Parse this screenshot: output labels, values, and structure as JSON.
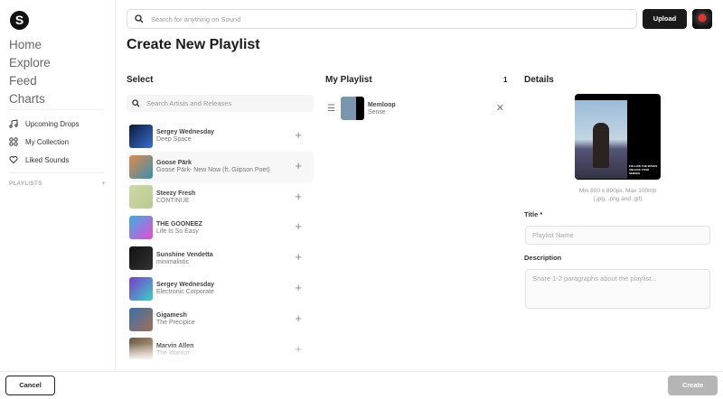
{
  "sidebar": {
    "logo": "S",
    "main_nav": [
      "Home",
      "Explore",
      "Feed",
      "Charts"
    ],
    "sub_nav": [
      {
        "label": "Upcoming Drops",
        "icon": "music-note-icon"
      },
      {
        "label": "My Collection",
        "icon": "grid-icon"
      },
      {
        "label": "Liked Sounds",
        "icon": "heart-icon"
      }
    ],
    "playlists_label": "PLAYLISTS",
    "playlists_add": "+"
  },
  "header": {
    "search_placeholder": "Search for anything on Sound",
    "upload_label": "Upload"
  },
  "page_title": "Create New Playlist",
  "select": {
    "heading": "Select",
    "search_placeholder": "Search Artists and Releases",
    "items": [
      {
        "artist": "Sergey Wednesday",
        "title": "Deep Space",
        "colors": [
          "#0b1a3a",
          "#3a6fd0"
        ]
      },
      {
        "artist": "Goose Pärk",
        "title": "Goose Pärk- New Now (ft. Giipson Poet)",
        "colors": [
          "#e08a4a",
          "#3a8fb0"
        ]
      },
      {
        "artist": "Steezy Fresh",
        "title": "CONTINUE",
        "colors": [
          "#cfd9a8",
          "#b9c98e"
        ]
      },
      {
        "artist": "THE GOONEEZ",
        "title": "Life Is So Easy",
        "colors": [
          "#3ab0e8",
          "#e84ad0"
        ]
      },
      {
        "artist": "Sunshine Vendetta",
        "title": "minimalistic",
        "colors": [
          "#111",
          "#333"
        ]
      },
      {
        "artist": "Sergey Wednesday",
        "title": "Electronic Corporate",
        "colors": [
          "#7a3ad0",
          "#3ad0c0"
        ]
      },
      {
        "artist": "Gigamesh",
        "title": "The Precipice",
        "colors": [
          "#3a6fb0",
          "#a07050"
        ]
      },
      {
        "artist": "Marvin Allen",
        "title": "The Warrior",
        "colors": [
          "#6a5a4a",
          "#c0a080"
        ]
      }
    ]
  },
  "my_playlist": {
    "heading": "My Playlist",
    "count": "1",
    "items": [
      {
        "artist": "Memloop",
        "title": "Sense"
      }
    ]
  },
  "details": {
    "heading": "Details",
    "cover_text": "FOLLOW THE WAVES UNLOCK YOUR SENSES",
    "hint_line1": "Min 800 x 800px, Max 100mb",
    "hint_line2": "(.jpg, .png and .gif)",
    "title_label": "Title *",
    "title_placeholder": "Playlist Name",
    "description_label": "Description",
    "description_placeholder": "Share 1-2 paragraphs about the playlist..."
  },
  "footer": {
    "cancel_label": "Cancel",
    "create_label": "Create"
  }
}
